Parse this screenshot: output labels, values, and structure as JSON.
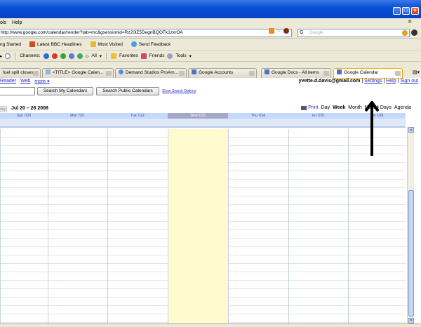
{
  "browser": {
    "menu": [
      "ols",
      "Help"
    ],
    "url": "http://www.google.com/calendar/render?tab=mc&gsessionid=Rz20lZ5DegnBQOTk1zxrOA",
    "search_placeholder": "Google",
    "search_logo": "G"
  },
  "bookmarks": [
    {
      "label": "ng Started",
      "icon": "page-icon",
      "color": "#d9d9d9"
    },
    {
      "label": "Latest BBC Headlines",
      "icon": "rss-icon",
      "color": "#d84a1a"
    },
    {
      "label": "Most Visited",
      "icon": "folder-icon",
      "color": "#e8b832"
    },
    {
      "label": "Send Feedback",
      "icon": "feedback-icon",
      "color": "#4aa0e0"
    }
  ],
  "toolbar": {
    "channels_label": "Channels:",
    "all_label": "All",
    "favorites_label": "Favorites",
    "friends_label": "Friends",
    "tools_label": "Tools"
  },
  "tabs": [
    {
      "label": "fuel spill closes..."
    },
    {
      "label": "<TITLE> Google Calen..."
    },
    {
      "label": "Demand Studios ProAm..."
    },
    {
      "label": "Google Accounts"
    },
    {
      "label": "Google Docs - All items"
    },
    {
      "label": "Google Calendar"
    }
  ],
  "calendar": {
    "links": [
      "Reader",
      "Web",
      "more"
    ],
    "more_arrow": "▾",
    "email": "yvette.d.davis@gmail.com",
    "separator": "|",
    "account_links": [
      "Settings",
      "Help",
      "Sign out"
    ],
    "search_my_label": "Search My Calendars",
    "search_public_label": "Search Public Calendars",
    "show_options_label": "Show Search Options",
    "today_label": "Today",
    "date_range": "Jul 20 – 26 2008",
    "print_label": "Print",
    "views": [
      "Day",
      "Week",
      "Month",
      "Next 4 Days",
      "Agenda"
    ],
    "day_headers": [
      "Sun 7/20",
      "Mon 7/21",
      "Tue 7/22",
      "Wed 7/23",
      "Thu 7/24",
      "Fri 7/25",
      "Sat 7/26"
    ],
    "today_index": 3,
    "today_color": "#fffbcf"
  }
}
